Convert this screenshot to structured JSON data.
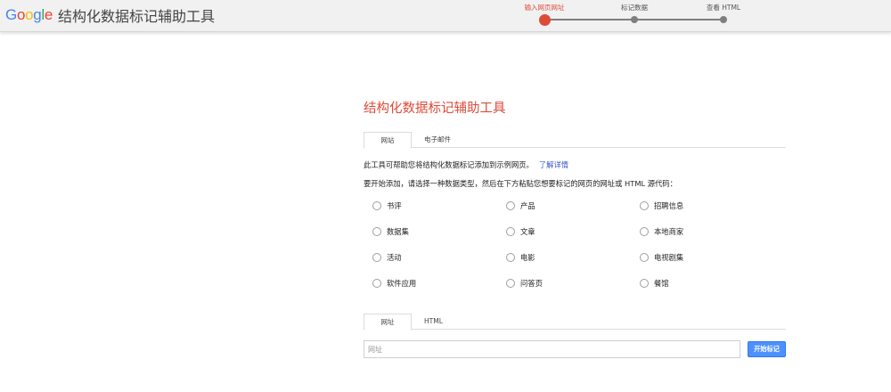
{
  "header": {
    "logo_letters": [
      {
        "char": "G",
        "color": "#4285f4"
      },
      {
        "char": "o",
        "color": "#ea4335"
      },
      {
        "char": "o",
        "color": "#fbbc05"
      },
      {
        "char": "g",
        "color": "#4285f4"
      },
      {
        "char": "l",
        "color": "#34a853"
      },
      {
        "char": "e",
        "color": "#ea4335"
      }
    ],
    "app_title": "结构化数据标记辅助工具",
    "steps": [
      {
        "label": "输入网页网址",
        "active": true
      },
      {
        "label": "标记数据",
        "active": false
      },
      {
        "label": "查看 HTML",
        "active": false
      }
    ]
  },
  "main": {
    "title": "结构化数据标记辅助工具",
    "source_tabs": [
      "网站",
      "电子邮件"
    ],
    "intro_text": "此工具可帮助您将结构化数据标记添加到示例网页。",
    "learn_more": "了解详情",
    "instruction": "要开始添加，请选择一种数据类型，然后在下方粘贴您想要标记的网页的网址或 HTML 源代码：",
    "data_types": [
      "书评",
      "产品",
      "招聘信息",
      "数据集",
      "文章",
      "本地商家",
      "活动",
      "电影",
      "电视剧集",
      "软件应用",
      "问答页",
      "餐馆"
    ],
    "input_tabs": [
      "网址",
      "HTML"
    ],
    "url_placeholder": "网址",
    "start_button": "开始标记"
  },
  "colors": {
    "accent": "#dd4b39",
    "button": "#4d90fe",
    "link": "#3b58c4"
  }
}
